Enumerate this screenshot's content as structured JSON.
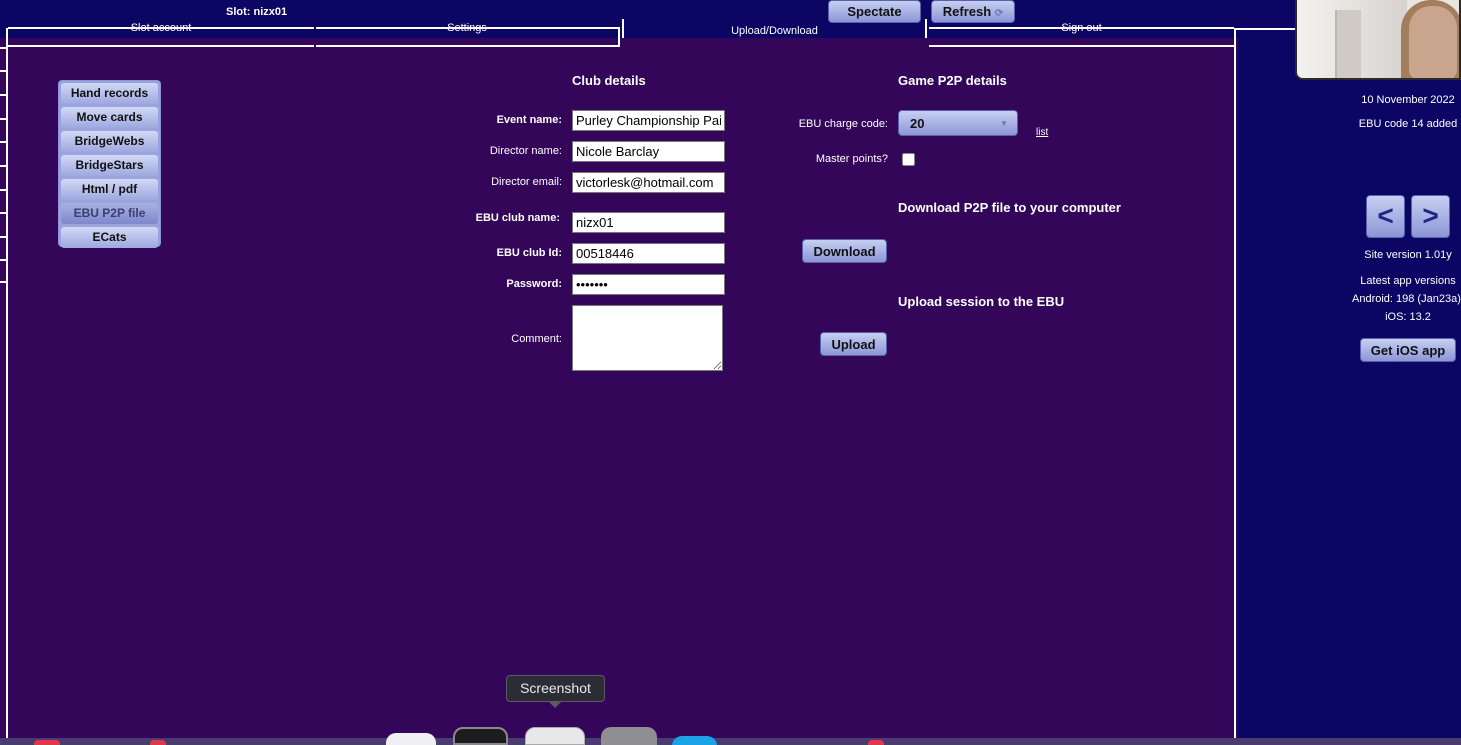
{
  "header": {
    "slot_label": "Slot: nizx01",
    "spectate_label": "Spectate",
    "refresh_label": "Refresh",
    "refresh_icon": "⟳",
    "tabs": [
      {
        "label": "Slot account"
      },
      {
        "label": "Settings"
      },
      {
        "label": "Upload/Download"
      },
      {
        "label": "Sign out"
      }
    ]
  },
  "menu": {
    "items": [
      {
        "label": "Hand records"
      },
      {
        "label": "Move cards"
      },
      {
        "label": "BridgeWebs"
      },
      {
        "label": "BridgeStars"
      },
      {
        "label": "Html / pdf"
      },
      {
        "label": "EBU P2P file"
      },
      {
        "label": "ECats"
      }
    ],
    "active": "EBU P2P file"
  },
  "club": {
    "title": "Club details",
    "event_name_label": "Event name:",
    "event_name_value": "Purley Championship Pairs",
    "director_name_label": "Director name:",
    "director_name_value": "Nicole Barclay",
    "director_email_label": "Director email:",
    "director_email_value": "victorlesk@hotmail.com",
    "ebu_club_name_label": "EBU club name:",
    "ebu_club_name_value": "nizx01",
    "ebu_club_id_label": "EBU club Id:",
    "ebu_club_id_value": "00518446",
    "password_label": "Password:",
    "password_value": "•••••••",
    "comment_label": "Comment:",
    "comment_value": ""
  },
  "game": {
    "title": "Game P2P details",
    "charge_code_label": "EBU charge code:",
    "charge_code_value": "20",
    "charge_arrow": "▼",
    "list_link": "list",
    "master_points_label": "Master points?",
    "master_points_checked": false,
    "download_heading": "Download P2P file to your computer",
    "download_label": "Download",
    "upload_heading": "Upload session to the EBU",
    "upload_label": "Upload"
  },
  "sidebar_right": {
    "date": "10 November 2022",
    "news": "EBU code 14 added",
    "prev_label": "<",
    "next_label": ">",
    "site_version": "Site version 1.01y",
    "latest_heading": "Latest app versions",
    "android": "Android: 198 (Jan23a)",
    "ios": "iOS: 13.2",
    "get_ios_label": "Get iOS app"
  },
  "dock": {
    "tooltip": "Screenshot"
  },
  "colors": {
    "page_bg": "#33065a",
    "band_bg": "#0b0563",
    "button_gradient_top": "#c6cff2",
    "button_gradient_bottom": "#8c96d6"
  }
}
